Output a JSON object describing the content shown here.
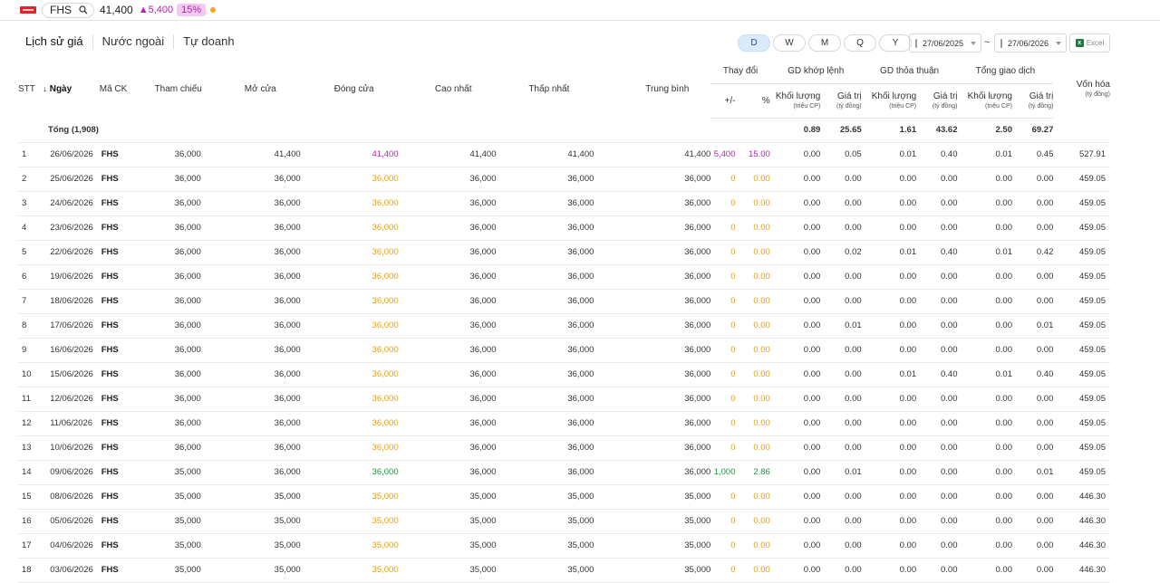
{
  "topbar": {
    "ticker": "FHS",
    "price": "41,400",
    "change": "5,400",
    "change_pct": "15%"
  },
  "tabs": [
    "Lịch sử giá",
    "Nước ngoài",
    "Tự doanh"
  ],
  "periods": [
    "D",
    "W",
    "M",
    "Q",
    "Y"
  ],
  "active_period": "D",
  "date_from": "27/06/2025",
  "date_sep": "~",
  "date_to": "27/06/2026",
  "excel_label": "Excel",
  "headers": {
    "stt": "STT",
    "date": "Ngày",
    "code": "Mã CK",
    "ref": "Tham chiếu",
    "open": "Mở cửa",
    "close": "Đóng cửa",
    "high": "Cao nhất",
    "low": "Thấp nhất",
    "avg": "Trung bình",
    "change": "Thay đổi",
    "change_abs": "+/-",
    "change_pct": "%",
    "matched": "GD khớp lệnh",
    "deal": "GD thỏa thuận",
    "total": "Tổng giao dịch",
    "volume": "Khối lượng",
    "volume_unit": "(triệu CP)",
    "value": "Giá trị",
    "value_unit": "(tỷ đồng)",
    "mcap": "Vốn hóa",
    "mcap_unit": "(tỷ đồng)"
  },
  "total_row": {
    "label": "Tổng (1,908)",
    "matched_vol": "0.89",
    "matched_val": "25.65",
    "deal_vol": "1.61",
    "deal_val": "43.62",
    "total_vol": "2.50",
    "total_val": "69.27"
  },
  "rows": [
    {
      "stt": "1",
      "date": "26/06/2026",
      "code": "FHS",
      "ref": "36,000",
      "open": "41,400",
      "close": "41,400",
      "close_color": "purple",
      "high": "41,400",
      "low": "41,400",
      "avg": "41,400",
      "chg": "5,400",
      "pct": "15.00",
      "mv": "0.00",
      "mval": "0.05",
      "dv": "0.01",
      "dval": "0.40",
      "tv": "0.01",
      "tval": "0.45",
      "mcap": "527.91"
    },
    {
      "stt": "2",
      "date": "25/06/2026",
      "code": "FHS",
      "ref": "36,000",
      "open": "36,000",
      "close": "36,000",
      "close_color": "orange",
      "high": "36,000",
      "low": "36,000",
      "avg": "36,000",
      "chg": "0",
      "pct": "0.00",
      "mv": "0.00",
      "mval": "0.00",
      "dv": "0.00",
      "dval": "0.00",
      "tv": "0.00",
      "tval": "0.00",
      "mcap": "459.05"
    },
    {
      "stt": "3",
      "date": "24/06/2026",
      "code": "FHS",
      "ref": "36,000",
      "open": "36,000",
      "close": "36,000",
      "close_color": "orange",
      "high": "36,000",
      "low": "36,000",
      "avg": "36,000",
      "chg": "0",
      "pct": "0.00",
      "mv": "0.00",
      "mval": "0.00",
      "dv": "0.00",
      "dval": "0.00",
      "tv": "0.00",
      "tval": "0.00",
      "mcap": "459.05"
    },
    {
      "stt": "4",
      "date": "23/06/2026",
      "code": "FHS",
      "ref": "36,000",
      "open": "36,000",
      "close": "36,000",
      "close_color": "orange",
      "high": "36,000",
      "low": "36,000",
      "avg": "36,000",
      "chg": "0",
      "pct": "0.00",
      "mv": "0.00",
      "mval": "0.00",
      "dv": "0.00",
      "dval": "0.00",
      "tv": "0.00",
      "tval": "0.00",
      "mcap": "459.05"
    },
    {
      "stt": "5",
      "date": "22/06/2026",
      "code": "FHS",
      "ref": "36,000",
      "open": "36,000",
      "close": "36,000",
      "close_color": "orange",
      "high": "36,000",
      "low": "36,000",
      "avg": "36,000",
      "chg": "0",
      "pct": "0.00",
      "mv": "0.00",
      "mval": "0.02",
      "dv": "0.01",
      "dval": "0.40",
      "tv": "0.01",
      "tval": "0.42",
      "mcap": "459.05"
    },
    {
      "stt": "6",
      "date": "19/06/2026",
      "code": "FHS",
      "ref": "36,000",
      "open": "36,000",
      "close": "36,000",
      "close_color": "orange",
      "high": "36,000",
      "low": "36,000",
      "avg": "36,000",
      "chg": "0",
      "pct": "0.00",
      "mv": "0.00",
      "mval": "0.00",
      "dv": "0.00",
      "dval": "0.00",
      "tv": "0.00",
      "tval": "0.00",
      "mcap": "459.05"
    },
    {
      "stt": "7",
      "date": "18/06/2026",
      "code": "FHS",
      "ref": "36,000",
      "open": "36,000",
      "close": "36,000",
      "close_color": "orange",
      "high": "36,000",
      "low": "36,000",
      "avg": "36,000",
      "chg": "0",
      "pct": "0.00",
      "mv": "0.00",
      "mval": "0.00",
      "dv": "0.00",
      "dval": "0.00",
      "tv": "0.00",
      "tval": "0.00",
      "mcap": "459.05"
    },
    {
      "stt": "8",
      "date": "17/06/2026",
      "code": "FHS",
      "ref": "36,000",
      "open": "36,000",
      "close": "36,000",
      "close_color": "orange",
      "high": "36,000",
      "low": "36,000",
      "avg": "36,000",
      "chg": "0",
      "pct": "0.00",
      "mv": "0.00",
      "mval": "0.01",
      "dv": "0.00",
      "dval": "0.00",
      "tv": "0.00",
      "tval": "0.01",
      "mcap": "459.05"
    },
    {
      "stt": "9",
      "date": "16/06/2026",
      "code": "FHS",
      "ref": "36,000",
      "open": "36,000",
      "close": "36,000",
      "close_color": "orange",
      "high": "36,000",
      "low": "36,000",
      "avg": "36,000",
      "chg": "0",
      "pct": "0.00",
      "mv": "0.00",
      "mval": "0.00",
      "dv": "0.00",
      "dval": "0.00",
      "tv": "0.00",
      "tval": "0.00",
      "mcap": "459.05"
    },
    {
      "stt": "10",
      "date": "15/06/2026",
      "code": "FHS",
      "ref": "36,000",
      "open": "36,000",
      "close": "36,000",
      "close_color": "orange",
      "high": "36,000",
      "low": "36,000",
      "avg": "36,000",
      "chg": "0",
      "pct": "0.00",
      "mv": "0.00",
      "mval": "0.00",
      "dv": "0.01",
      "dval": "0.40",
      "tv": "0.01",
      "tval": "0.40",
      "mcap": "459.05"
    },
    {
      "stt": "11",
      "date": "12/06/2026",
      "code": "FHS",
      "ref": "36,000",
      "open": "36,000",
      "close": "36,000",
      "close_color": "orange",
      "high": "36,000",
      "low": "36,000",
      "avg": "36,000",
      "chg": "0",
      "pct": "0.00",
      "mv": "0.00",
      "mval": "0.00",
      "dv": "0.00",
      "dval": "0.00",
      "tv": "0.00",
      "tval": "0.00",
      "mcap": "459.05"
    },
    {
      "stt": "12",
      "date": "11/06/2026",
      "code": "FHS",
      "ref": "36,000",
      "open": "36,000",
      "close": "36,000",
      "close_color": "orange",
      "high": "36,000",
      "low": "36,000",
      "avg": "36,000",
      "chg": "0",
      "pct": "0.00",
      "mv": "0.00",
      "mval": "0.00",
      "dv": "0.00",
      "dval": "0.00",
      "tv": "0.00",
      "tval": "0.00",
      "mcap": "459.05"
    },
    {
      "stt": "13",
      "date": "10/06/2026",
      "code": "FHS",
      "ref": "36,000",
      "open": "36,000",
      "close": "36,000",
      "close_color": "orange",
      "high": "36,000",
      "low": "36,000",
      "avg": "36,000",
      "chg": "0",
      "pct": "0.00",
      "mv": "0.00",
      "mval": "0.00",
      "dv": "0.00",
      "dval": "0.00",
      "tv": "0.00",
      "tval": "0.00",
      "mcap": "459.05"
    },
    {
      "stt": "14",
      "date": "09/06/2026",
      "code": "FHS",
      "ref": "35,000",
      "open": "36,000",
      "close": "36,000",
      "close_color": "green",
      "high": "36,000",
      "low": "36,000",
      "avg": "36,000",
      "chg": "1,000",
      "pct": "2.86",
      "mv": "0.00",
      "mval": "0.01",
      "dv": "0.00",
      "dval": "0.00",
      "tv": "0.00",
      "tval": "0.01",
      "mcap": "459.05"
    },
    {
      "stt": "15",
      "date": "08/06/2026",
      "code": "FHS",
      "ref": "35,000",
      "open": "35,000",
      "close": "35,000",
      "close_color": "orange",
      "high": "35,000",
      "low": "35,000",
      "avg": "35,000",
      "chg": "0",
      "pct": "0.00",
      "mv": "0.00",
      "mval": "0.00",
      "dv": "0.00",
      "dval": "0.00",
      "tv": "0.00",
      "tval": "0.00",
      "mcap": "446.30"
    },
    {
      "stt": "16",
      "date": "05/06/2026",
      "code": "FHS",
      "ref": "35,000",
      "open": "35,000",
      "close": "35,000",
      "close_color": "orange",
      "high": "35,000",
      "low": "35,000",
      "avg": "35,000",
      "chg": "0",
      "pct": "0.00",
      "mv": "0.00",
      "mval": "0.00",
      "dv": "0.00",
      "dval": "0.00",
      "tv": "0.00",
      "tval": "0.00",
      "mcap": "446.30"
    },
    {
      "stt": "17",
      "date": "04/06/2026",
      "code": "FHS",
      "ref": "35,000",
      "open": "35,000",
      "close": "35,000",
      "close_color": "orange",
      "high": "35,000",
      "low": "35,000",
      "avg": "35,000",
      "chg": "0",
      "pct": "0.00",
      "mv": "0.00",
      "mval": "0.00",
      "dv": "0.00",
      "dval": "0.00",
      "tv": "0.00",
      "tval": "0.00",
      "mcap": "446.30"
    },
    {
      "stt": "18",
      "date": "03/06/2026",
      "code": "FHS",
      "ref": "35,000",
      "open": "35,000",
      "close": "35,000",
      "close_color": "orange",
      "high": "35,000",
      "low": "35,000",
      "avg": "35,000",
      "chg": "0",
      "pct": "0.00",
      "mv": "0.00",
      "mval": "0.00",
      "dv": "0.00",
      "dval": "0.00",
      "tv": "0.00",
      "tval": "0.00",
      "mcap": "446.30"
    }
  ]
}
